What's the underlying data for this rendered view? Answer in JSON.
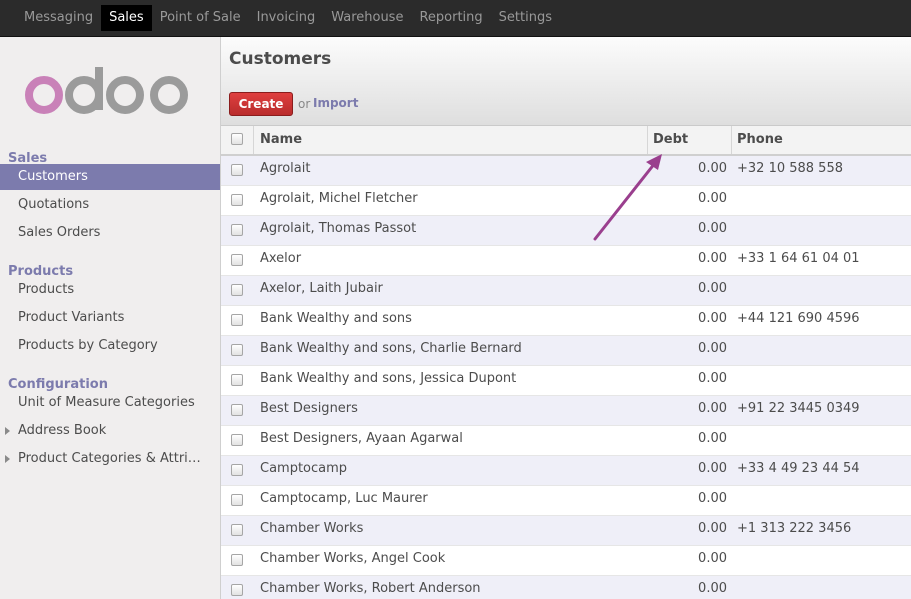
{
  "topbar": {
    "menu": [
      "Messaging",
      "Sales",
      "Point of Sale",
      "Invoicing",
      "Warehouse",
      "Reporting",
      "Settings"
    ],
    "active": "Sales"
  },
  "sidebar": {
    "logo_text": "odoo",
    "sections": [
      {
        "title": "Sales",
        "items": [
          "Customers",
          "Quotations",
          "Sales Orders"
        ]
      },
      {
        "title": "Products",
        "items": [
          "Products",
          "Product Variants",
          "Products by Category"
        ]
      },
      {
        "title": "Configuration",
        "items": [
          "Unit of Measure Categories",
          "Address Book",
          "Product Categories & Attri…"
        ]
      }
    ],
    "active_item": "Customers"
  },
  "control_panel": {
    "title": "Customers",
    "create_label": "Create",
    "or_text": "or",
    "import_label": "Import"
  },
  "table": {
    "columns": {
      "name": "Name",
      "debt": "Debt",
      "phone": "Phone"
    },
    "rows": [
      {
        "name": "Agrolait",
        "debt": "0.00",
        "phone": "+32 10 588 558"
      },
      {
        "name": "Agrolait, Michel Fletcher",
        "debt": "0.00",
        "phone": ""
      },
      {
        "name": "Agrolait, Thomas Passot",
        "debt": "0.00",
        "phone": ""
      },
      {
        "name": "Axelor",
        "debt": "0.00",
        "phone": "+33 1 64 61 04 01"
      },
      {
        "name": "Axelor, Laith Jubair",
        "debt": "0.00",
        "phone": ""
      },
      {
        "name": "Bank Wealthy and sons",
        "debt": "0.00",
        "phone": "+44 121 690 4596"
      },
      {
        "name": "Bank Wealthy and sons, Charlie Bernard",
        "debt": "0.00",
        "phone": ""
      },
      {
        "name": "Bank Wealthy and sons, Jessica Dupont",
        "debt": "0.00",
        "phone": ""
      },
      {
        "name": "Best Designers",
        "debt": "0.00",
        "phone": "+91 22 3445 0349"
      },
      {
        "name": "Best Designers, Ayaan Agarwal",
        "debt": "0.00",
        "phone": ""
      },
      {
        "name": "Camptocamp",
        "debt": "0.00",
        "phone": "+33 4 49 23 44 54"
      },
      {
        "name": "Camptocamp, Luc Maurer",
        "debt": "0.00",
        "phone": ""
      },
      {
        "name": "Chamber Works",
        "debt": "0.00",
        "phone": "+1 313 222 3456"
      },
      {
        "name": "Chamber Works, Angel Cook",
        "debt": "0.00",
        "phone": ""
      },
      {
        "name": "Chamber Works, Robert Anderson",
        "debt": "0.00",
        "phone": ""
      }
    ]
  },
  "colors": {
    "accent": "#7c7bad",
    "create": "#c93434",
    "arrow": "#9a3f8e",
    "logo_purple": "#c981b8",
    "logo_grey": "#9b9b9b"
  }
}
